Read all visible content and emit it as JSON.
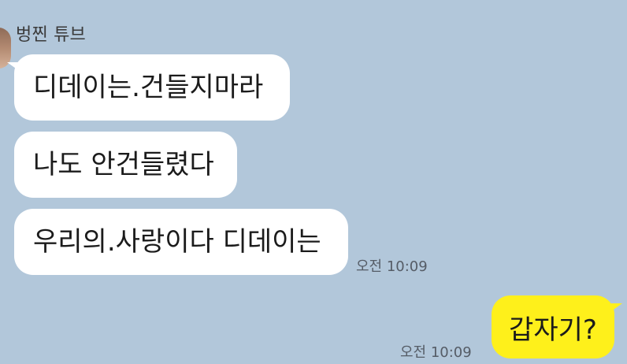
{
  "chat": {
    "sender_name": "벙찐 튜브",
    "incoming": [
      {
        "text": "디데이는.건들지마라"
      },
      {
        "text": "나도 안건들렸다"
      },
      {
        "text": "우리의.사랑이다 디데이는"
      }
    ],
    "incoming_time": "오전 10:09",
    "outgoing": {
      "text": "갑자기?"
    },
    "outgoing_time": "오전 10:09"
  },
  "colors": {
    "background": "#b2c7da",
    "incoming_bubble": "#ffffff",
    "outgoing_bubble": "#fef01b"
  },
  "icons": {
    "avatar": "profile-avatar"
  }
}
